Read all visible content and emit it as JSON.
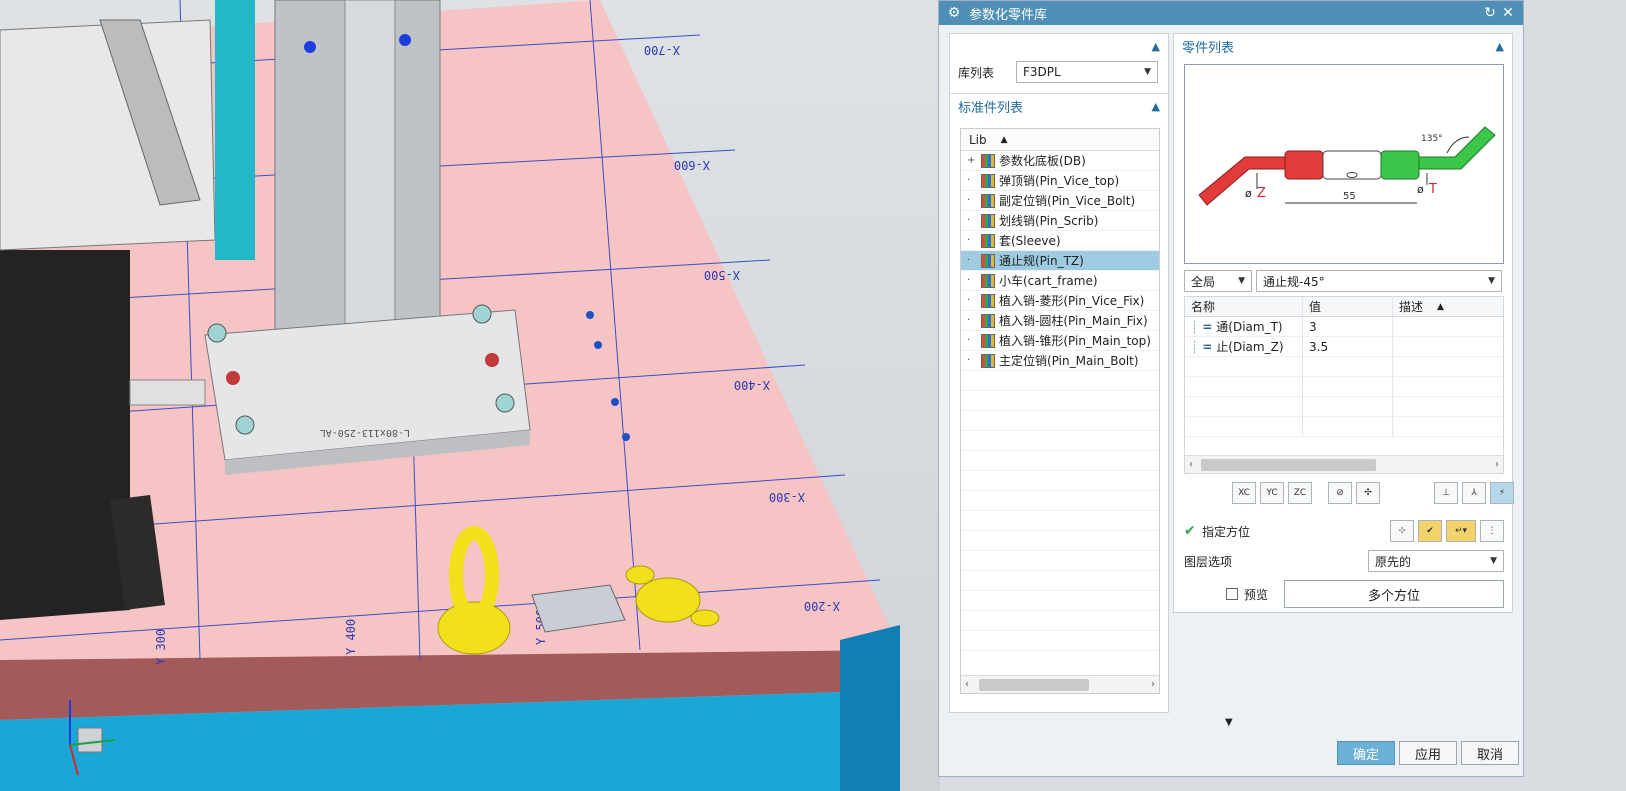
{
  "viewport": {
    "grid_labels_x": [
      "X-700",
      "X-600",
      "X-500",
      "X-400",
      "X-300",
      "X-200"
    ],
    "grid_labels_y": [
      "Y 300",
      "Y 400",
      "Y 500"
    ],
    "plate_marking": "L-80x113-250-AL"
  },
  "dialog": {
    "title": "参数化零件库",
    "library_section": {
      "label": "库列表",
      "value": "F3DPL"
    },
    "standard_parts": {
      "header": "标准件列表",
      "column": "Lib",
      "items": [
        {
          "label": "参数化底板(DB)",
          "expandable": true
        },
        {
          "label": "弹顶销(Pin_Vice_top)"
        },
        {
          "label": "副定位销(Pin_Vice_Bolt)"
        },
        {
          "label": "划线销(Pin_Scrib)"
        },
        {
          "label": "套(Sleeve)"
        },
        {
          "label": "通止规(Pin_TZ)",
          "selected": true
        },
        {
          "label": "小车(cart_frame)"
        },
        {
          "label": "植入销-菱形(Pin_Vice_Fix)"
        },
        {
          "label": "植入销-圆柱(Pin_Main_Fix)"
        },
        {
          "label": "植入销-锥形(Pin_Main_top)"
        },
        {
          "label": "主定位销(Pin_Main_Bolt)"
        }
      ]
    },
    "parts_list": {
      "header": "零件列表",
      "preview": {
        "angle": "135°",
        "dim_length": "55",
        "label_z": "Z",
        "label_t": "T",
        "phi": "ø"
      },
      "scope_select": "全局",
      "part_select": "通止规-45°",
      "table": {
        "columns": [
          "名称",
          "值",
          "描述"
        ],
        "rows": [
          {
            "name": "通(Diam_T)",
            "value": "3",
            "desc": ""
          },
          {
            "name": "止(Diam_Z)",
            "value": "3.5",
            "desc": ""
          }
        ]
      },
      "axis_buttons": [
        "XC",
        "YC",
        "ZC"
      ],
      "specify_orientation": "指定方位",
      "layer_option_label": "图层选项",
      "layer_option_value": "原先的",
      "preview_checkbox": "预览",
      "multi_orientation": "多个方位"
    },
    "buttons": {
      "ok": "确定",
      "apply": "应用",
      "cancel": "取消"
    }
  },
  "colors": {
    "titlebar": "#4f8fb6",
    "accent_text": "#1f6da0",
    "selection": "#9fcbe0",
    "floor_pink": "#f6c4c4",
    "plate_edge": "#a35a5a",
    "frame_blue": "#1aa7d6"
  }
}
